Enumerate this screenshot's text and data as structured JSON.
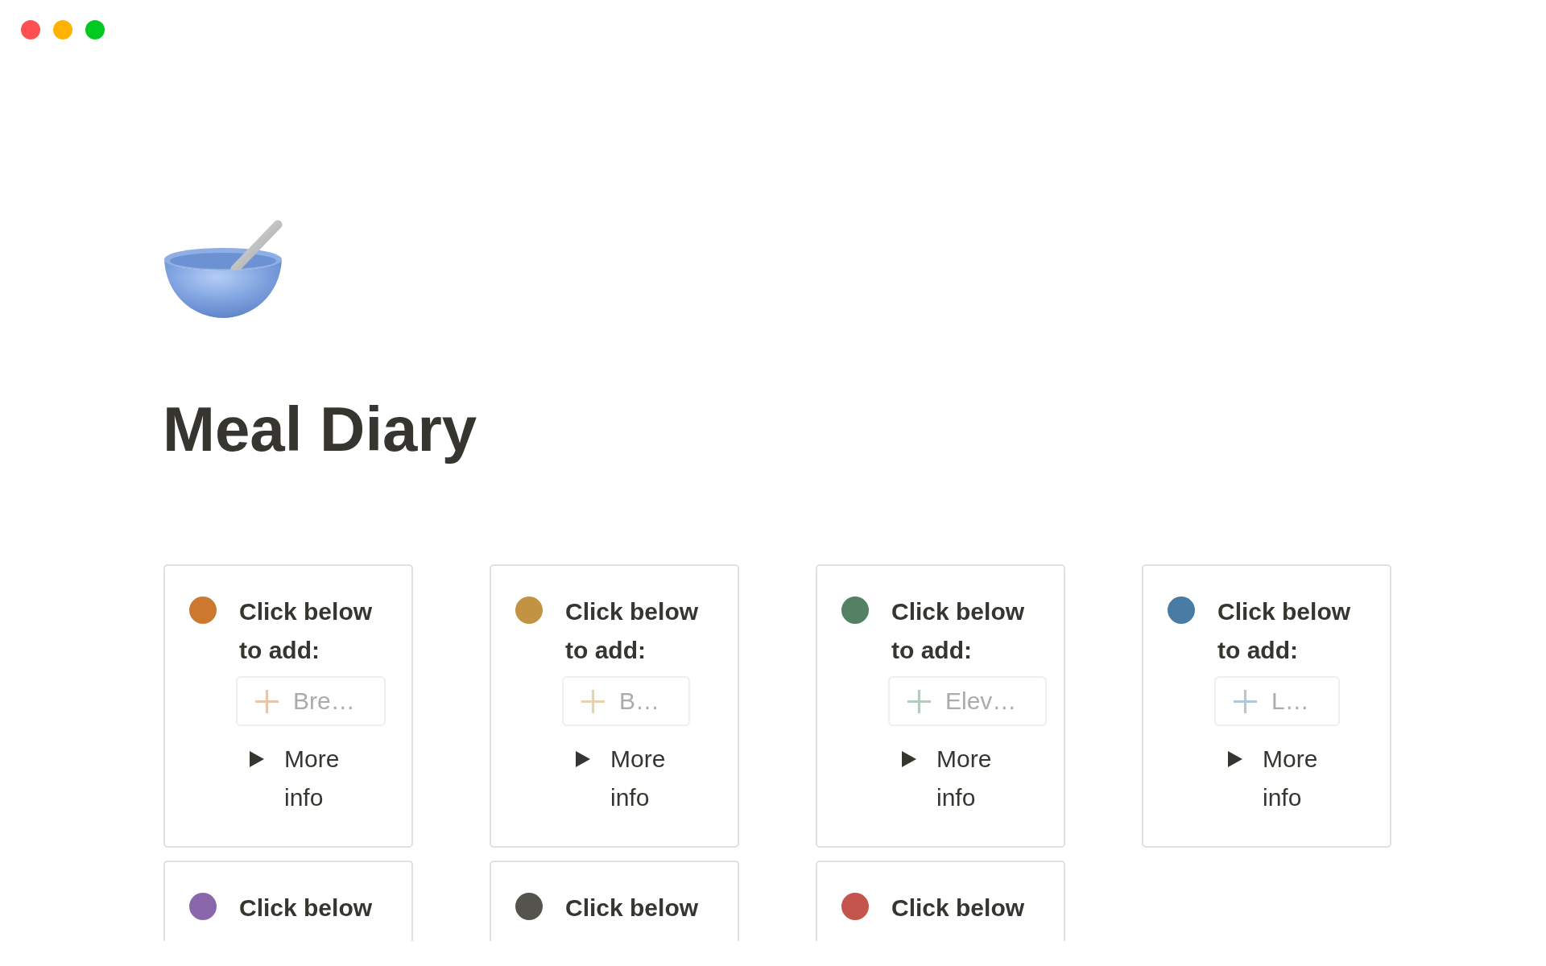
{
  "page": {
    "title": "Meal Diary"
  },
  "cards": [
    {
      "color": "#cc782f",
      "heading": "Click below to add:",
      "add_button": {
        "label": "Bre…"
      },
      "toggle": {
        "label": "More info",
        "expanded": false
      }
    },
    {
      "color": "#c29343",
      "heading": "Click below to add:",
      "add_button": {
        "label": "B…"
      },
      "toggle": {
        "label": "More info",
        "expanded": false
      }
    },
    {
      "color": "#548164",
      "heading": "Click below to add:",
      "add_button": {
        "label": "Elev…"
      },
      "toggle": {
        "label": "More info",
        "expanded": false
      }
    },
    {
      "color": "#487ca5",
      "heading": "Click below to add:",
      "add_button": {
        "label": "L…"
      },
      "toggle": {
        "label": "More info",
        "expanded": false
      }
    },
    {
      "color": "#8a67ab",
      "heading": "Click below"
    },
    {
      "color": "#55534e",
      "heading": "Click below"
    },
    {
      "color": "#c4554d",
      "heading": "Click below"
    }
  ]
}
